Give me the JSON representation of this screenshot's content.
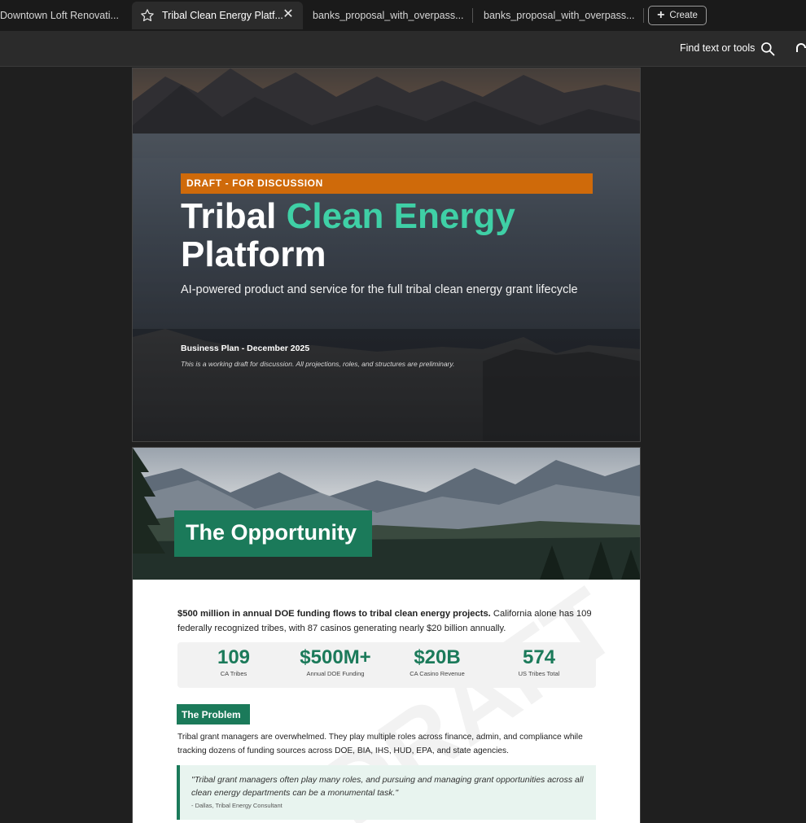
{
  "tabs": [
    {
      "label": "Downtown Loft Renovati..."
    },
    {
      "label": "Tribal Clean Energy Platf..."
    },
    {
      "label": "banks_proposal_with_overpass..."
    },
    {
      "label": "banks_proposal_with_overpass..."
    }
  ],
  "create_label": "Create",
  "toolbar": {
    "find_label": "Find text or tools"
  },
  "cover": {
    "banner": "DRAFT - FOR DISCUSSION",
    "title_part1": "Tribal ",
    "title_accent": "Clean Energy",
    "title_part2": "Platform",
    "subtitle": "AI-powered product and service for the full tribal clean energy grant lifecycle",
    "date": "Business Plan - December 2025",
    "note": "This is a working draft for discussion. All projections, roles, and structures are preliminary."
  },
  "page2": {
    "header": "The Opportunity",
    "lead_bold": "$500 million in annual DOE funding flows to tribal clean energy projects.",
    "lead_rest": " California alone has 109 federally recognized tribes, with 87 casinos generating nearly $20 billion annually.",
    "stats": [
      {
        "value": "109",
        "label": "CA Tribes"
      },
      {
        "value": "$500M+",
        "label": "Annual DOE Funding"
      },
      {
        "value": "$20B",
        "label": "CA Casino Revenue"
      },
      {
        "value": "574",
        "label": "US Tribes Total"
      }
    ],
    "problem_heading": "The Problem",
    "problem_text": "Tribal grant managers are overwhelmed. They play multiple roles across finance, admin, and compliance while tracking dozens of funding sources across DOE, BIA, IHS, HUD, EPA, and state agencies.",
    "quote": "\"Tribal grant managers often play many roles, and pursuing and managing grant opportunities across all clean energy departments can be a monumental task.\"",
    "quote_attr": "- Dallas, Tribal Energy Consultant",
    "watermark": "DRAFT"
  },
  "colors": {
    "accent_green": "#1b7a5a",
    "title_teal": "#3fd0a6",
    "banner_orange": "#cf6a0a"
  }
}
